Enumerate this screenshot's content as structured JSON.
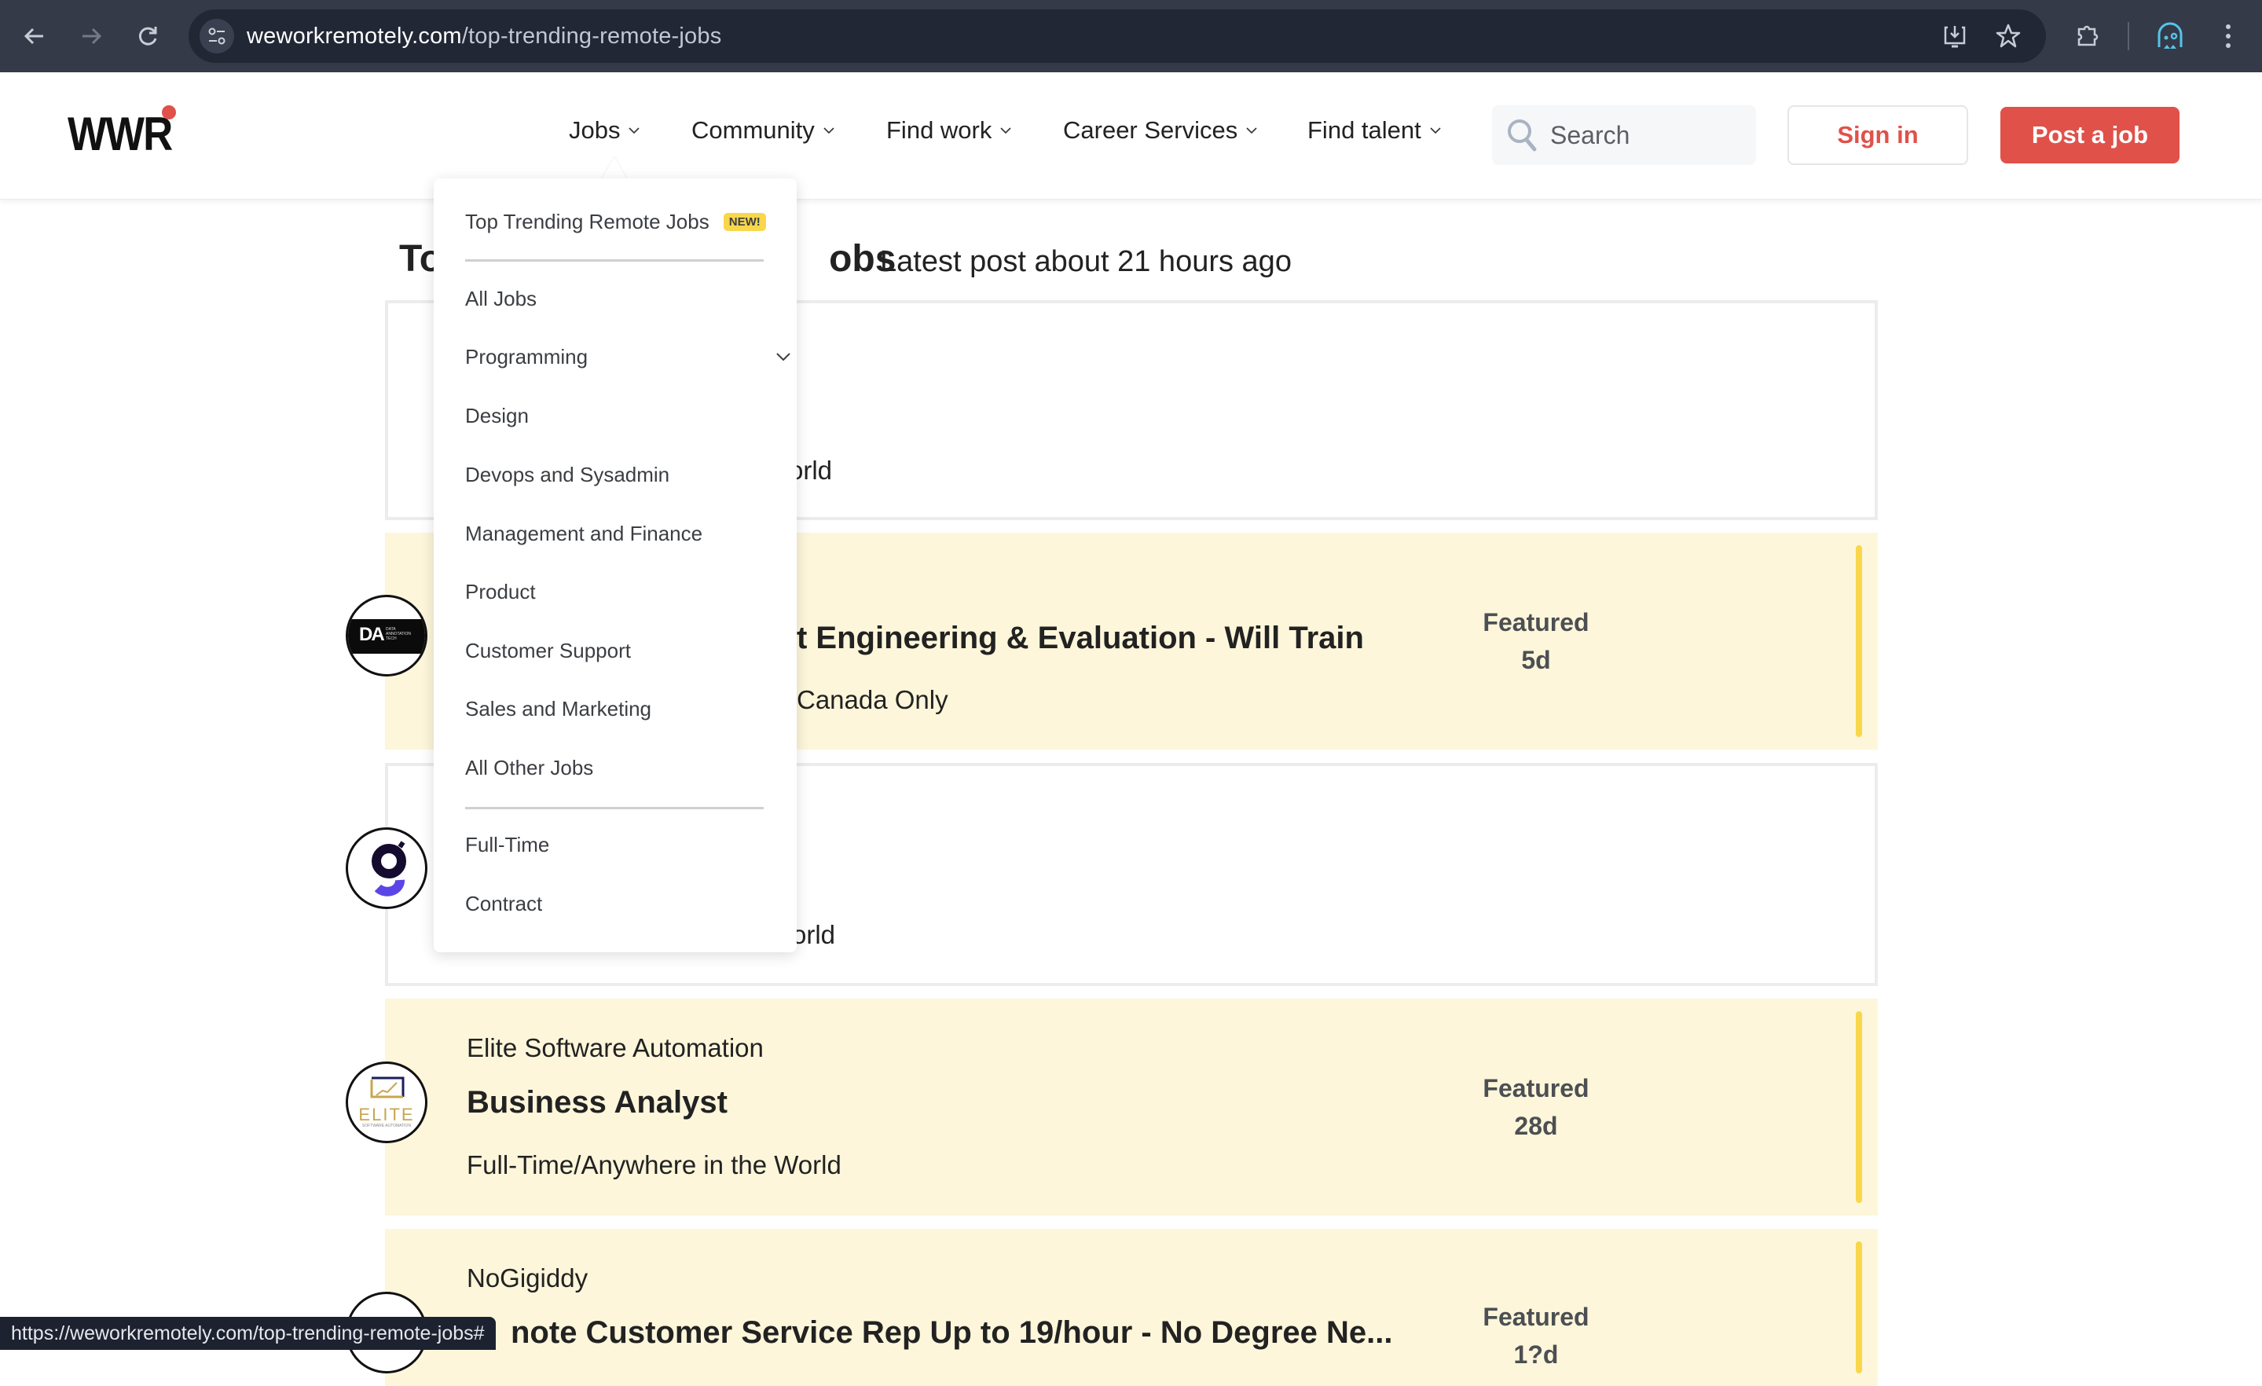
{
  "browser": {
    "url_host": "weworkremotely.com",
    "url_path": "/top-trending-remote-jobs",
    "status_url": "https://weworkremotely.com/top-trending-remote-jobs#",
    "icons": [
      "back-icon",
      "forward-icon",
      "reload-icon",
      "site-info-icon",
      "install-app-icon",
      "bookmark-star-icon",
      "extensions-icon",
      "profile-icon",
      "menu-kebab-icon"
    ]
  },
  "header": {
    "logo": "WWR",
    "nav": [
      {
        "label": "Jobs"
      },
      {
        "label": "Community"
      },
      {
        "label": "Find work"
      },
      {
        "label": "Career Services"
      },
      {
        "label": "Find talent"
      }
    ],
    "search_placeholder": "Search",
    "sign_in": "Sign in",
    "post_job": "Post a job"
  },
  "colors": {
    "brand_red": "#e0514a",
    "featured_bg": "#fdf6da",
    "featured_bar": "#f8d74a",
    "badge_yellow": "#f8d74a"
  },
  "main": {
    "title_visible_left": "To",
    "title_visible_right": "obs",
    "subtitle": "Latest post about 21 hours ago"
  },
  "jobs_menu": {
    "top_item": "Top Trending Remote Jobs",
    "top_badge": "NEW!",
    "categories": [
      {
        "label": "All Jobs"
      },
      {
        "label": "Programming",
        "has_submenu": true
      },
      {
        "label": "Design"
      },
      {
        "label": "Devops and Sysadmin"
      },
      {
        "label": "Management and Finance"
      },
      {
        "label": "Product"
      },
      {
        "label": "Customer Support"
      },
      {
        "label": "Sales and Marketing"
      },
      {
        "label": "All Other Jobs"
      }
    ],
    "types": [
      {
        "label": "Full-Time"
      },
      {
        "label": "Contract"
      }
    ]
  },
  "jobs": [
    {
      "featured": false,
      "company": "",
      "title": "",
      "meta_visible": "orld"
    },
    {
      "featured": true,
      "logo": "DATA ANNOTATION TECH",
      "logo_mark": "DA",
      "logo_sub": [
        "DATA",
        "ANNOTATION",
        "TECH"
      ],
      "title_visible": "t Engineering & Evaluation - Will Train",
      "meta_visible": "Canada Only",
      "badge": "Featured",
      "age": "5d"
    },
    {
      "featured": false,
      "logo_mark": "g",
      "meta_visible": "orld"
    },
    {
      "featured": true,
      "logo_mark": "ELITE",
      "logo_sub": "SOFTWARE AUTOMATION",
      "company": "Elite Software Automation",
      "title": "Business Analyst",
      "meta": "Full-Time/Anywhere in the World",
      "badge": "Featured",
      "age": "28d"
    },
    {
      "featured": true,
      "company": "NoGigiddy",
      "title_visible": "note Customer Service Rep Up to 19/hour - No Degree Ne...",
      "badge": "Featured",
      "age": "1?d"
    }
  ]
}
